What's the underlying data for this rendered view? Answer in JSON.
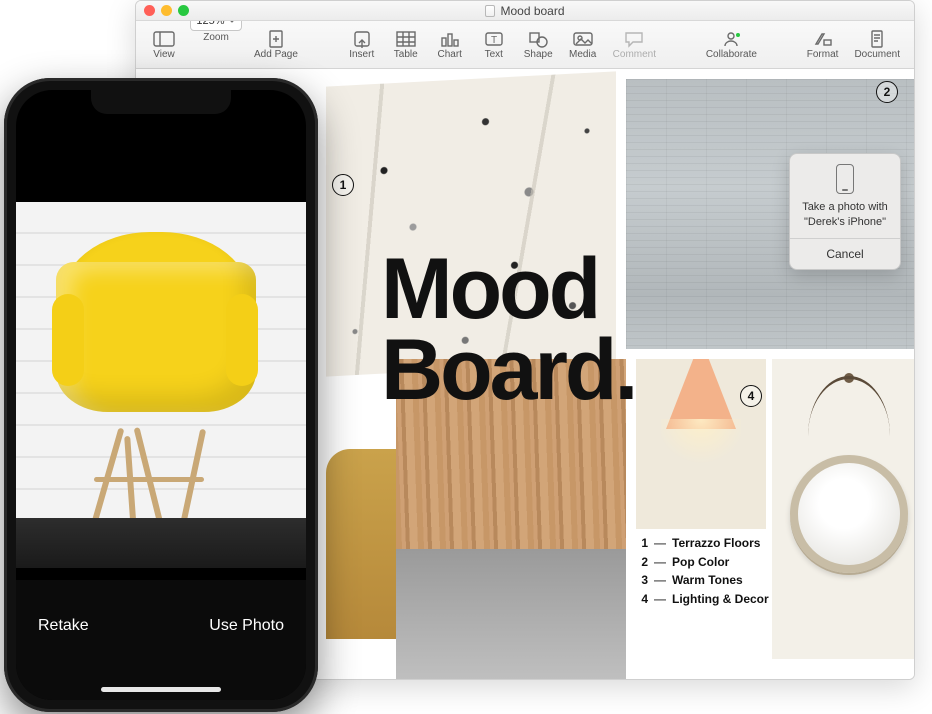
{
  "window": {
    "title": "Mood board",
    "traffic": {
      "close": "close",
      "minimize": "minimize",
      "maximize": "maximize"
    }
  },
  "toolbar": {
    "view": "View",
    "zoom_value": "125%",
    "zoom_label": "Zoom",
    "add_page": "Add Page",
    "insert": "Insert",
    "table": "Table",
    "chart": "Chart",
    "text": "Text",
    "shape": "Shape",
    "media": "Media",
    "comment": "Comment",
    "collaborate": "Collaborate",
    "format": "Format",
    "document": "Document"
  },
  "board": {
    "heading_line1": "Mood",
    "heading_line2": "Board.",
    "markers": {
      "m1": "1",
      "m2": "2",
      "m4": "4"
    },
    "legend": [
      {
        "n": "1",
        "label": "Terrazzo Floors"
      },
      {
        "n": "2",
        "label": "Pop Color"
      },
      {
        "n": "3",
        "label": "Warm Tones"
      },
      {
        "n": "4",
        "label": "Lighting & Decor"
      }
    ]
  },
  "popover": {
    "message": "Take a photo with \"Derek's iPhone\"",
    "cancel": "Cancel"
  },
  "iphone": {
    "retake": "Retake",
    "use_photo": "Use Photo"
  }
}
